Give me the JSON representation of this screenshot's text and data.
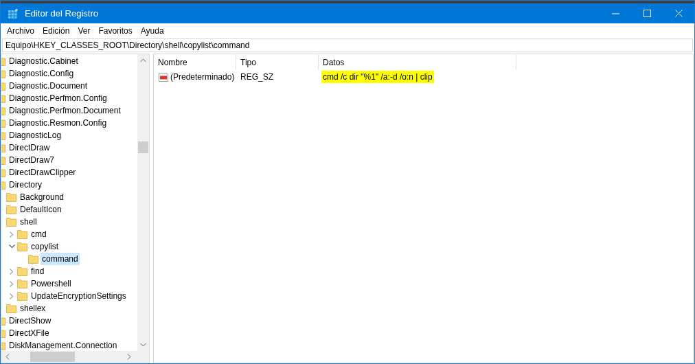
{
  "window": {
    "title": "Editor del Registro"
  },
  "menu": [
    "Archivo",
    "Edición",
    "Ver",
    "Favoritos",
    "Ayuda"
  ],
  "address": "Equipo\\HKEY_CLASSES_ROOT\\Directory\\shell\\copylist\\command",
  "tree": [
    {
      "label": "Diagnostic.Cabinet",
      "selected": false
    },
    {
      "label": "Diagnostic.Config",
      "selected": false
    },
    {
      "label": "Diagnostic.Document",
      "selected": false
    },
    {
      "label": "Diagnostic.Perfmon.Config",
      "selected": false
    },
    {
      "label": "Diagnostic.Perfmon.Document",
      "selected": false
    },
    {
      "label": "Diagnostic.Resmon.Config",
      "selected": false
    },
    {
      "label": "DiagnosticLog",
      "selected": false
    },
    {
      "label": "DirectDraw",
      "selected": false
    },
    {
      "label": "DirectDraw7",
      "selected": false
    },
    {
      "label": "DirectDrawClipper",
      "selected": false
    },
    {
      "label": "Directory",
      "selected": false,
      "children": [
        {
          "label": "Background",
          "selected": false
        },
        {
          "label": "DefaultIcon",
          "selected": false
        },
        {
          "label": "shell",
          "selected": false,
          "children": [
            {
              "label": "cmd",
              "selected": false,
              "expanded": false
            },
            {
              "label": "copylist",
              "selected": false,
              "expanded": true,
              "children": [
                {
                  "label": "command",
                  "selected": true
                }
              ]
            },
            {
              "label": "find",
              "selected": false,
              "expanded": false
            },
            {
              "label": "Powershell",
              "selected": false,
              "expanded": false
            },
            {
              "label": "UpdateEncryptionSettings",
              "selected": false,
              "expanded": false
            }
          ]
        },
        {
          "label": "shellex",
          "selected": false
        }
      ]
    },
    {
      "label": "DirectShow",
      "selected": false
    },
    {
      "label": "DirectXFile",
      "selected": false
    },
    {
      "label": "DiskManagement.Connection",
      "selected": false
    }
  ],
  "table": {
    "columns": [
      "Nombre",
      "Tipo",
      "Datos"
    ],
    "rows": [
      {
        "name": "(Predeterminado)",
        "type": "REG_SZ",
        "data": "cmd /c dir \"%1\" /a:-d /o:n | clip",
        "highlighted": true
      }
    ]
  }
}
